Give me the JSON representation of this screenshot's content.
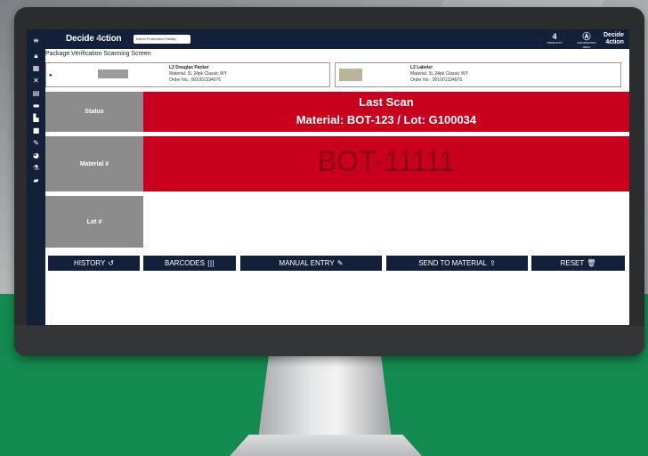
{
  "app": {
    "brand_prefix": "Decide",
    "brand_four": "4",
    "brand_suffix": "ction",
    "facility": "Demo Production Facility",
    "page_title": "Package Verification Scanning Screen",
    "topbar_right": {
      "products_count": "4",
      "products_label": "PRODUCTS",
      "information_label": "INFORMATION MENU",
      "logo_line1": "Decide",
      "logo_line2": "4ction"
    }
  },
  "sidebar": {
    "icons": [
      "menu-icon",
      "lock-icon",
      "grid-icon",
      "tools-icon",
      "chart-icon",
      "card-icon",
      "factory-icon",
      "box-icon",
      "edit-icon",
      "pie-icon",
      "flask-icon",
      "briefcase-icon"
    ]
  },
  "stations": [
    {
      "name": "L2 Douglas Packer",
      "material": "Material: 3L 24pk Classic WY",
      "order": "Order No.: 001001334076"
    },
    {
      "name": "L2 Labeler",
      "material": "Material: 3L 24pk Classic WY",
      "order": "Order No.: 001001334076"
    }
  ],
  "rows": {
    "status_label": "Status",
    "last_scan_title": "Last Scan",
    "last_scan_material": "Material: BOT-123 / Lot: G100034",
    "material_label": "Material #",
    "material_value": "BOT-11111",
    "lot_label": "Lot #",
    "lot_value": ""
  },
  "buttons": {
    "history": "HISTORY",
    "barcodes": "BARCODES",
    "manual_entry": "MANUAL ENTRY",
    "send_to_material": "SEND TO MATERIAL",
    "reset": "RESET"
  },
  "colors": {
    "navy": "#12203a",
    "alert_red": "#c8001e",
    "label_gray": "#8c8c8c",
    "background_green": "#138a4f"
  }
}
